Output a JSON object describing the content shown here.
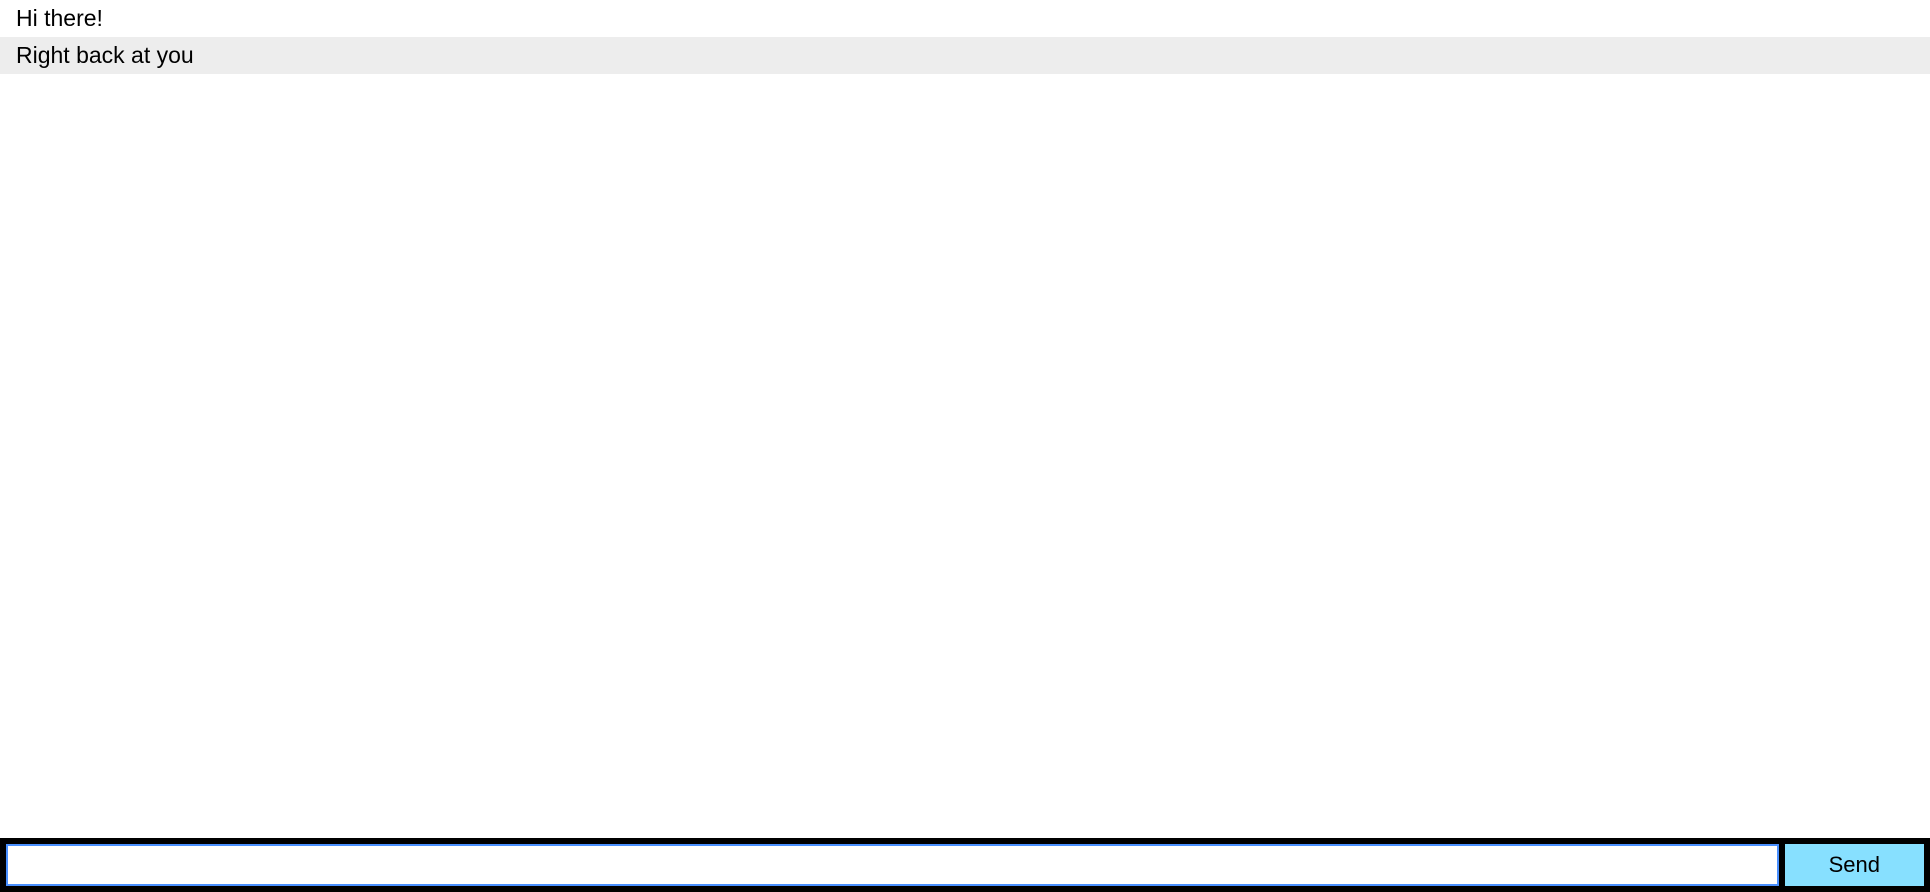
{
  "messages": [
    {
      "text": "Hi there!"
    },
    {
      "text": "Right back at you"
    }
  ],
  "input": {
    "value": "",
    "send_label": "Send"
  }
}
